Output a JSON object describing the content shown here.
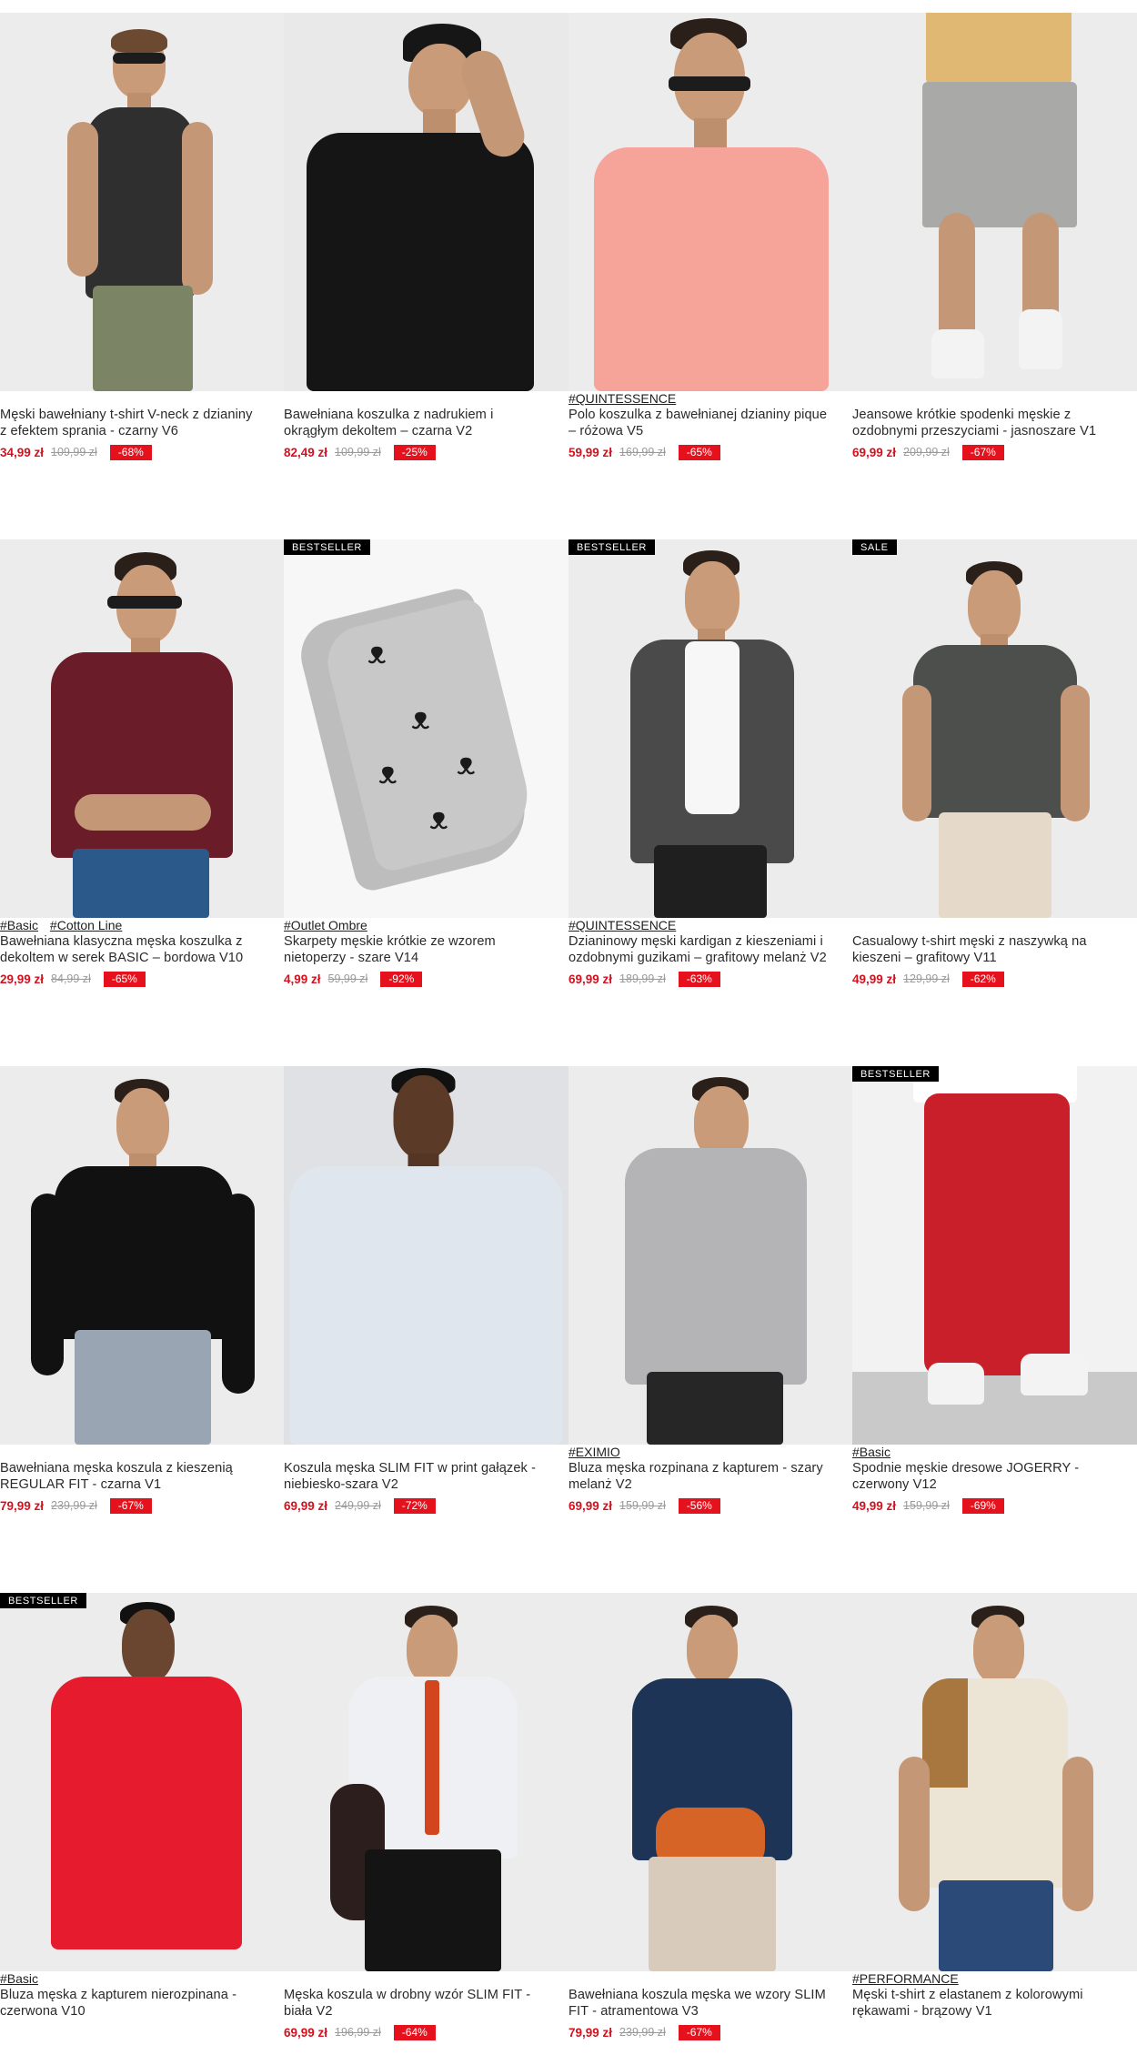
{
  "colors": {
    "price": "#d3121f",
    "discount_bg": "#e5121d",
    "badge_bg": "#000000"
  },
  "products": [
    {
      "badge": "",
      "tags": [],
      "name": "Męski bawełniany t-shirt V-neck z dzianiny\nz efektem sprania - czarny V6",
      "price": "34,99 zł",
      "old_price": "109,99 zł",
      "discount": "-68%"
    },
    {
      "badge": "",
      "tags": [],
      "name": "Bawełniana koszulka z nadrukiem i\nokrągłym dekoltem – czarna V2",
      "price": "82,49 zł",
      "old_price": "109,99 zł",
      "discount": "-25%"
    },
    {
      "badge": "",
      "tags": [
        "#QUINTESSENCE"
      ],
      "name": "Polo koszulka z bawełnianej dzianiny pique\n– różowa V5",
      "price": "59,99 zł",
      "old_price": "169,99 zł",
      "discount": "-65%"
    },
    {
      "badge": "",
      "tags": [],
      "name": "Jeansowe krótkie spodenki męskie z\nozdobnymi przeszyciami - jasnoszare V1",
      "price": "69,99 zł",
      "old_price": "209,99 zł",
      "discount": "-67%"
    },
    {
      "badge": "",
      "tags": [
        "#Basic",
        "#Cotton Line"
      ],
      "name": "Bawełniana klasyczna męska koszulka z\ndekoltem w serek BASIC – bordowa V10",
      "price": "29,99 zł",
      "old_price": "84,99 zł",
      "discount": "-65%"
    },
    {
      "badge": "BESTSELLER",
      "tags": [
        "#Outlet Ombre"
      ],
      "name": "Skarpety męskie krótkie ze wzorem\nnietoperzy - szare V14",
      "price": "4,99 zł",
      "old_price": "59,99 zł",
      "discount": "-92%"
    },
    {
      "badge": "BESTSELLER",
      "tags": [
        "#QUINTESSENCE"
      ],
      "name": "Dzianinowy męski kardigan z kieszeniami i\nozdobnymi guzikami – grafitowy melanż V2",
      "price": "69,99 zł",
      "old_price": "189,99 zł",
      "discount": "-63%"
    },
    {
      "badge": "SALE",
      "tags": [],
      "name": "Casualowy t-shirt męski z naszywką na\nkieszeni – grafitowy V11",
      "price": "49,99 zł",
      "old_price": "129,99 zł",
      "discount": "-62%"
    },
    {
      "badge": "",
      "tags": [],
      "name": "Bawełniana męska koszula z kieszenią\nREGULAR FIT - czarna V1",
      "price": "79,99 zł",
      "old_price": "239,99 zł",
      "discount": "-67%"
    },
    {
      "badge": "",
      "tags": [],
      "name": "Koszula męska SLIM FIT w print gałązek -\nniebiesko-szara V2",
      "price": "69,99 zł",
      "old_price": "249,99 zł",
      "discount": "-72%"
    },
    {
      "badge": "",
      "tags": [
        "#EXIMIO"
      ],
      "name": "Bluza męska rozpinana z kapturem - szary\nmelanż V2",
      "price": "69,99 zł",
      "old_price": "159,99 zł",
      "discount": "-56%"
    },
    {
      "badge": "BESTSELLER",
      "tags": [
        "#Basic"
      ],
      "name": "Spodnie męskie dresowe JOGERRY -\nczerwony V12",
      "price": "49,99 zł",
      "old_price": "159,99 zł",
      "discount": "-69%"
    },
    {
      "badge": "BESTSELLER",
      "tags": [
        "#Basic"
      ],
      "name": "Bluza męska z kapturem nierozpinana -\nczerwona V10",
      "price": "",
      "old_price": "",
      "discount": ""
    },
    {
      "badge": "",
      "tags": [],
      "name": "Męska koszula w drobny wzór SLIM FIT -\nbiała V2",
      "price": "69,99 zł",
      "old_price": "196,99 zł",
      "discount": "-64%"
    },
    {
      "badge": "",
      "tags": [],
      "name": "Bawełniana koszula męska we wzory SLIM\nFIT - atramentowa V3",
      "price": "79,99 zł",
      "old_price": "239,99 zł",
      "discount": "-67%"
    },
    {
      "badge": "",
      "tags": [
        "#PERFORMANCE"
      ],
      "name": "Męski t-shirt z elastanem z kolorowymi\nrękawami - brązowy V1",
      "price": "",
      "old_price": "",
      "discount": ""
    }
  ]
}
